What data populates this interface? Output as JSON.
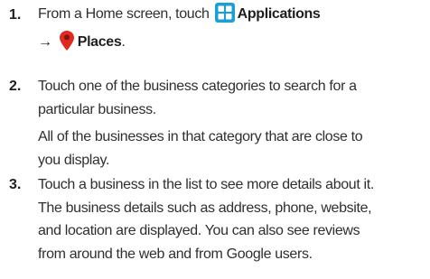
{
  "steps": [
    {
      "number": "1.",
      "line1_prefix": "From a Home screen, touch",
      "applications_label": "Applications",
      "arrow": "→",
      "places_label": "Places",
      "period": ".",
      "icons": [
        "applications-icon",
        "places-pin-icon"
      ]
    },
    {
      "number": "2.",
      "line1": "Touch one of the business categories to search for a",
      "line2": "particular business.",
      "line3": "All of the businesses in that category that are close to",
      "line4": "you display."
    },
    {
      "number": "3.",
      "line1": "Touch a business in the list to see more details about it.",
      "line2": "The business details such as address, phone, website,",
      "line3": "and location are displayed. You can also see reviews",
      "line4": "from around the web and from Google users."
    }
  ],
  "colors": {
    "applications_icon": "#1aa0d8",
    "places_pin": "#e02a1f",
    "text": "#2f2f2f"
  }
}
